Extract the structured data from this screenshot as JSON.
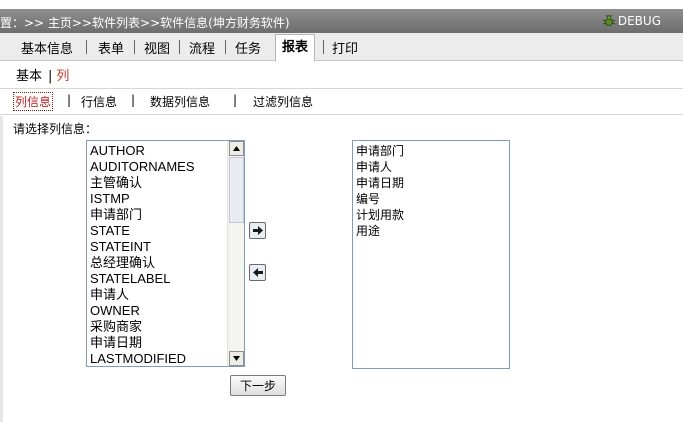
{
  "header": {
    "breadcrumb": "置：>> 主页>>软件列表>>软件信息(坤方财务软件)",
    "debug_label": "DEBUG"
  },
  "tabs": [
    "基本信息",
    "表单",
    "视图",
    "流程",
    "任务",
    "报表",
    "打印"
  ],
  "active_tab": "报表",
  "subtabs": {
    "basic": "基本",
    "column": "列"
  },
  "column_tabs": [
    "列信息",
    "行信息",
    "数据列信息",
    "过滤列信息"
  ],
  "prompt": "请选择列信息：",
  "available_columns": [
    "AUTHOR",
    "AUDITORNAMES",
    "主管确认",
    "ISTMP",
    "申请部门",
    "STATE",
    "STATEINT",
    "总经理确认",
    "STATELABEL",
    "申请人",
    "OWNER",
    "采购商家",
    "申请日期",
    "LASTMODIFIED"
  ],
  "selected_columns": [
    "申请部门",
    "申请人",
    "申请日期",
    "编号",
    "计划用款",
    "用途"
  ],
  "next_button": "下一步"
}
